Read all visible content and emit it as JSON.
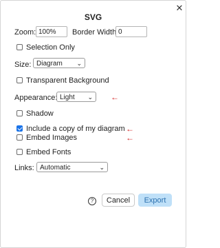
{
  "dialog": {
    "title": "SVG",
    "close_icon": "✕"
  },
  "zoom": {
    "label": "Zoom:",
    "value": "100%"
  },
  "border_width": {
    "label": "Border Width:",
    "value": "0"
  },
  "selection_only": {
    "label": "Selection Only",
    "checked": false
  },
  "size": {
    "label": "Size:",
    "selected": "Diagram"
  },
  "transparent_background": {
    "label": "Transparent Background",
    "checked": false
  },
  "appearance": {
    "label": "Appearance:",
    "selected": "Light"
  },
  "shadow": {
    "label": "Shadow",
    "checked": false
  },
  "include_copy": {
    "label": "Include a copy of my diagram",
    "checked": true
  },
  "embed_images": {
    "label": "Embed Images",
    "checked": false
  },
  "embed_fonts": {
    "label": "Embed Fonts",
    "checked": false
  },
  "links": {
    "label": "Links:",
    "selected": "Automatic"
  },
  "footer": {
    "help_icon": "?",
    "cancel_label": "Cancel",
    "export_label": "Export"
  },
  "annotations": {
    "arrow_glyph": "←",
    "arrow_color": "#d32020"
  },
  "colors": {
    "checkbox_checked": "#1a73e8",
    "export_bg": "#bfe0f8",
    "export_text": "#2a6fae"
  }
}
